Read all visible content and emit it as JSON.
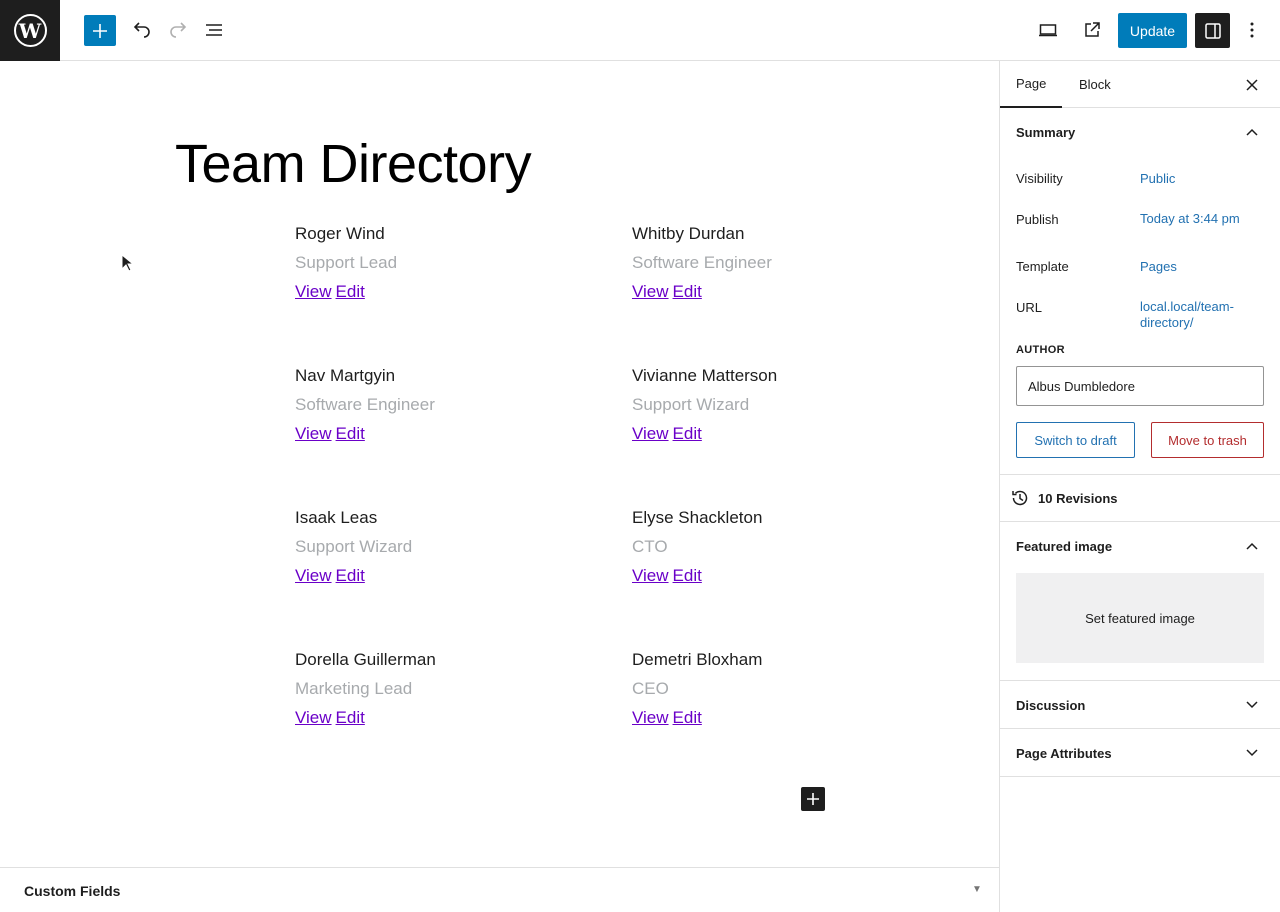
{
  "toolbar": {
    "logo_glyph": "W",
    "update_label": "Update"
  },
  "content": {
    "title": "Team Directory",
    "members": [
      {
        "name": "Roger Wind",
        "role": "Support Lead",
        "view": "View",
        "edit": "Edit"
      },
      {
        "name": "Whitby Durdan",
        "role": "Software Engineer",
        "view": "View",
        "edit": "Edit"
      },
      {
        "name": "Nav Martgyin",
        "role": "Software Engineer",
        "view": "View",
        "edit": "Edit"
      },
      {
        "name": "Vivianne Matterson",
        "role": "Support Wizard",
        "view": "View",
        "edit": "Edit"
      },
      {
        "name": "Isaak Leas",
        "role": "Support Wizard",
        "view": "View",
        "edit": "Edit"
      },
      {
        "name": "Elyse Shackleton",
        "role": "CTO",
        "view": "View",
        "edit": "Edit"
      },
      {
        "name": "Dorella Guillerman",
        "role": "Marketing Lead",
        "view": "View",
        "edit": "Edit"
      },
      {
        "name": "Demetri Bloxham",
        "role": "CEO",
        "view": "View",
        "edit": "Edit"
      }
    ]
  },
  "custom_fields": {
    "label": "Custom Fields"
  },
  "sidebar": {
    "tabs": [
      "Page",
      "Block"
    ],
    "summary": {
      "title": "Summary",
      "visibility_label": "Visibility",
      "visibility_value": "Public",
      "publish_label": "Publish",
      "publish_value": "Today at 3:44 pm",
      "template_label": "Template",
      "template_value": "Pages",
      "url_label": "URL",
      "url_value": "local.local/team-directory/",
      "author_label": "AUTHOR",
      "author_value": "Albus Dumbledore",
      "switch_draft": "Switch to draft",
      "move_trash": "Move to trash"
    },
    "revisions": "10 Revisions",
    "featured_image": {
      "title": "Featured image",
      "set_label": "Set featured image"
    },
    "discussion": "Discussion",
    "page_attributes": "Page Attributes"
  },
  "colors": {
    "accent": "#007cba",
    "link_visited": "#6a00c8",
    "danger": "#b32d2e",
    "muted": "#a7aaad"
  }
}
